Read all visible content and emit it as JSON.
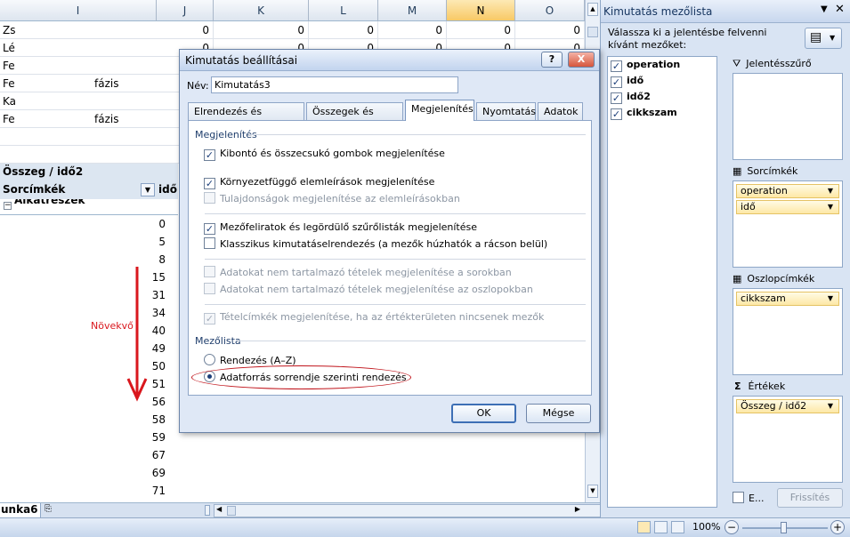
{
  "sheet": {
    "columns": [
      "I",
      "J",
      "K",
      "L",
      "M",
      "N",
      "O"
    ],
    "top_rows": [
      {
        "label": "Zs",
        "suffix": "",
        "values": [
          "0",
          "0",
          "0",
          "0",
          "0",
          "0"
        ]
      },
      {
        "label": "Lé",
        "suffix": "",
        "values": [
          "0",
          "0",
          "0",
          "0",
          "0",
          "0"
        ]
      },
      {
        "label": "Fe",
        "suffix": "",
        "values": [
          "0",
          "0",
          "0",
          "0",
          "0",
          "0"
        ]
      },
      {
        "label": "Fe",
        "suffix": "fázis",
        "values": [
          "0",
          "0",
          "0",
          "0",
          "0",
          "0"
        ]
      },
      {
        "label": "Ka",
        "suffix": "",
        "values": [
          "0",
          "0",
          "0",
          "0",
          "0",
          "0"
        ]
      },
      {
        "label": "Fe",
        "suffix": "fázis",
        "values": [
          "0",
          "0",
          "0",
          "0",
          "0",
          "0"
        ]
      }
    ],
    "pivot_title": "Összeg / idő2",
    "row_labels": "Sorcímkék",
    "col_field": "idő",
    "group_label": "Alkatrészek",
    "values": [
      "0",
      "5",
      "8",
      "15",
      "31",
      "34",
      "40",
      "49",
      "50",
      "51",
      "56",
      "58",
      "59",
      "67",
      "69",
      "71"
    ],
    "annotation": "Növekvő",
    "tab_fragment": "unka6",
    "arrow_color": "#d9171d"
  },
  "statusbar": {
    "zoom": "100%"
  },
  "fieldlist": {
    "title": "Kimutatás mezőlista",
    "prompt": "Válassza ki a jelentésbe felvenni kívánt mezőket:",
    "fields": [
      {
        "name": "operation",
        "checked": true
      },
      {
        "name": "idő",
        "checked": true
      },
      {
        "name": "idő2",
        "checked": true
      },
      {
        "name": "cikkszam",
        "checked": true
      }
    ],
    "areas": {
      "filter": {
        "label": "Jelentésszűrő",
        "items": []
      },
      "rows": {
        "label": "Sorcímkék",
        "items": [
          "operation",
          "idő"
        ]
      },
      "cols": {
        "label": "Oszlopcímkék",
        "items": [
          "cikkszam"
        ]
      },
      "values": {
        "label": "Értékek",
        "items": [
          "Összeg / idő2"
        ]
      }
    },
    "defer_label": "E...",
    "refresh_label": "Frissítés"
  },
  "dialog": {
    "title": "Kimutatás beállításai",
    "help": "?",
    "close": "X",
    "name_label": "Név:",
    "name_value": "Kimutatás3",
    "tabs": [
      "Elrendezés és formátum",
      "Összegek és szűrők",
      "Megjelenítés",
      "Nyomtatás",
      "Adatok"
    ],
    "active_tab": "Megjelenítés",
    "section_display": "Megjelenítés",
    "opt1": "Kibontó és összecsukó gombok megjelenítése",
    "opt2": "Környezetfüggő elemleírások megjelenítése",
    "opt3": "Tulajdonságok megjelenítése az elemleírásokban",
    "opt4": "Mezőfeliratok és legördülő szűrőlisták megjelenítése",
    "opt5": "Klasszikus kimutatáselrendezés (a mezők húzhatók a rácson belül)",
    "opt6": "Adatokat nem tartalmazó tételek megjelenítése a sorokban",
    "opt7": "Adatokat nem tartalmazó tételek megjelenítése az oszlopokban",
    "opt8": "Tételcímkék megjelenítése, ha az értékterületen nincsenek mezők",
    "section_fieldlist": "Mezőlista",
    "radio1": "Rendezés (A–Z)",
    "radio2": "Adatforrás sorrendje szerinti rendezés",
    "ok": "OK",
    "cancel": "Mégse",
    "highlight_color": "#c0141b"
  }
}
